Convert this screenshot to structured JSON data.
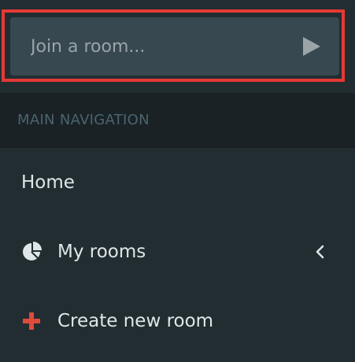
{
  "join": {
    "placeholder": "Join a room...",
    "submit_icon": "play-icon"
  },
  "nav": {
    "header": "MAIN NAVIGATION",
    "items": [
      {
        "label": "Home",
        "icon": ""
      },
      {
        "label": "My rooms",
        "icon": "pie-chart-icon",
        "trailing_icon": "chevron-left-icon"
      },
      {
        "label": "Create new room",
        "icon": "plus-icon"
      }
    ]
  },
  "colors": {
    "sidebar_bg": "#222d32",
    "header_bg": "#1a2226",
    "input_bg": "#374850",
    "highlight": "#e53935",
    "plus": "#dd4b39"
  }
}
